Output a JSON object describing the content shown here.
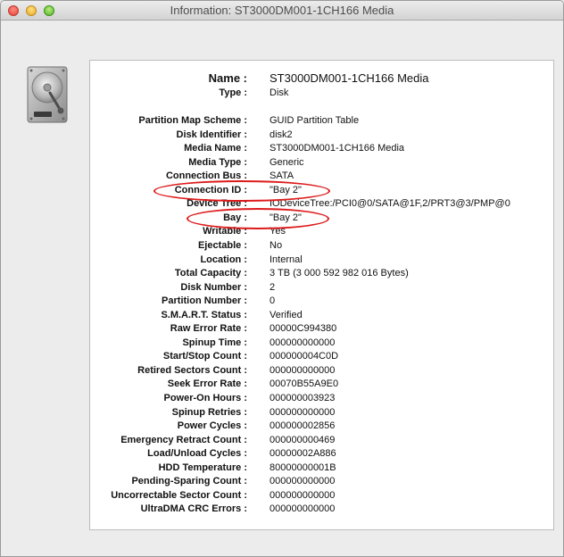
{
  "window": {
    "title": "Information: ST3000DM001-1CH166 Media"
  },
  "colors": {
    "annotation": "#dd1b1b",
    "panel_bg": "#ffffff",
    "window_bg": "#ececec"
  },
  "icon": "hard-disk-icon",
  "header": {
    "name_label": "Name :",
    "name_value": "ST3000DM001-1CH166 Media",
    "type_label": "Type :",
    "type_value": "Disk"
  },
  "properties": [
    {
      "label": "Partition Map Scheme :",
      "value": "GUID Partition Table"
    },
    {
      "label": "Disk Identifier :",
      "value": "disk2"
    },
    {
      "label": "Media Name :",
      "value": "ST3000DM001-1CH166 Media"
    },
    {
      "label": "Media Type :",
      "value": "Generic"
    },
    {
      "label": "Connection Bus :",
      "value": "SATA"
    },
    {
      "label": "Connection ID :",
      "value": "\"Bay 2\""
    },
    {
      "label": "Device Tree :",
      "value": "IODeviceTree:/PCI0@0/SATA@1F,2/PRT3@3/PMP@0"
    },
    {
      "label": "Bay :",
      "value": "\"Bay 2\""
    },
    {
      "label": "Writable :",
      "value": "Yes"
    },
    {
      "label": "Ejectable :",
      "value": "No"
    },
    {
      "label": "Location :",
      "value": "Internal"
    },
    {
      "label": "Total Capacity :",
      "value": "3 TB (3 000 592 982 016 Bytes)"
    },
    {
      "label": "Disk Number :",
      "value": "2"
    },
    {
      "label": "Partition Number :",
      "value": "0"
    },
    {
      "label": "S.M.A.R.T. Status :",
      "value": "Verified"
    },
    {
      "label": "Raw Error Rate :",
      "value": "00000C994380"
    },
    {
      "label": "Spinup Time :",
      "value": "000000000000"
    },
    {
      "label": "Start/Stop Count :",
      "value": "000000004C0D"
    },
    {
      "label": "Retired Sectors Count :",
      "value": "000000000000"
    },
    {
      "label": "Seek Error Rate :",
      "value": "00070B55A9E0"
    },
    {
      "label": "Power-On Hours :",
      "value": "000000003923"
    },
    {
      "label": "Spinup Retries :",
      "value": "000000000000"
    },
    {
      "label": "Power Cycles :",
      "value": "000000002856"
    },
    {
      "label": "Emergency Retract Count :",
      "value": "000000000469"
    },
    {
      "label": "Load/Unload Cycles :",
      "value": "00000002A886"
    },
    {
      "label": "HDD Temperature :",
      "value": "80000000001B"
    },
    {
      "label": "Pending-Sparing Count :",
      "value": "000000000000"
    },
    {
      "label": "Uncorrectable Sector Count :",
      "value": "000000000000"
    },
    {
      "label": "UltraDMA CRC Errors :",
      "value": "000000000000"
    }
  ]
}
